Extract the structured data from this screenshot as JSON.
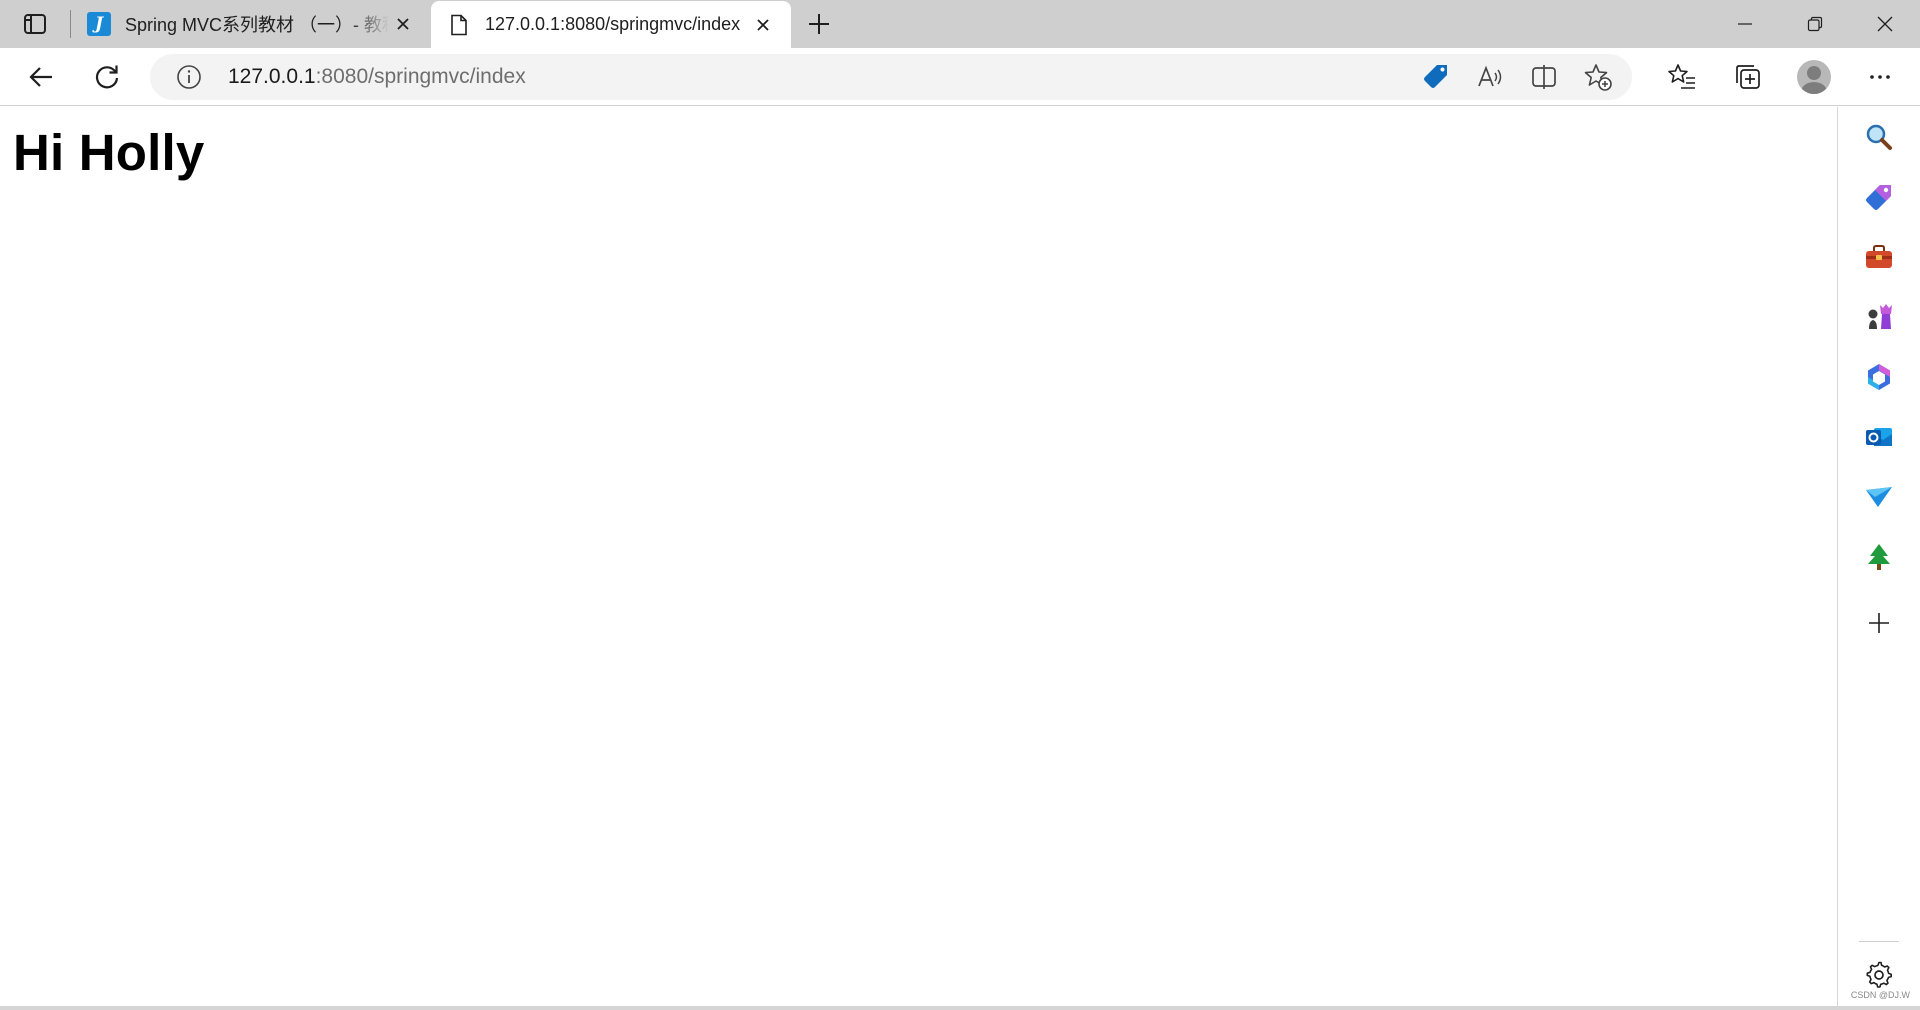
{
  "tabs": [
    {
      "title": "Spring MVC系列教材 （一）- 教程",
      "favicon": "J",
      "active": false
    },
    {
      "title": "127.0.0.1:8080/springmvc/index",
      "favicon": "page-icon",
      "active": true
    }
  ],
  "address_bar": {
    "host": "127.0.0.1",
    "path": ":8080/springmvc/index"
  },
  "page": {
    "heading": "Hi Holly"
  },
  "sidebar_items": [
    "search-icon",
    "shopping-tag-icon",
    "tools-briefcase-icon",
    "games-chess-icon",
    "microsoft-365-icon",
    "outlook-icon",
    "drop-send-icon",
    "tree-icon",
    "add-icon"
  ],
  "watermark": "CSDN @DJ.W",
  "colors": {
    "tabstrip_bg": "#cfcfcf",
    "accent_blue": "#0f6cbd",
    "favicon_blue": "#1a8ad6"
  }
}
